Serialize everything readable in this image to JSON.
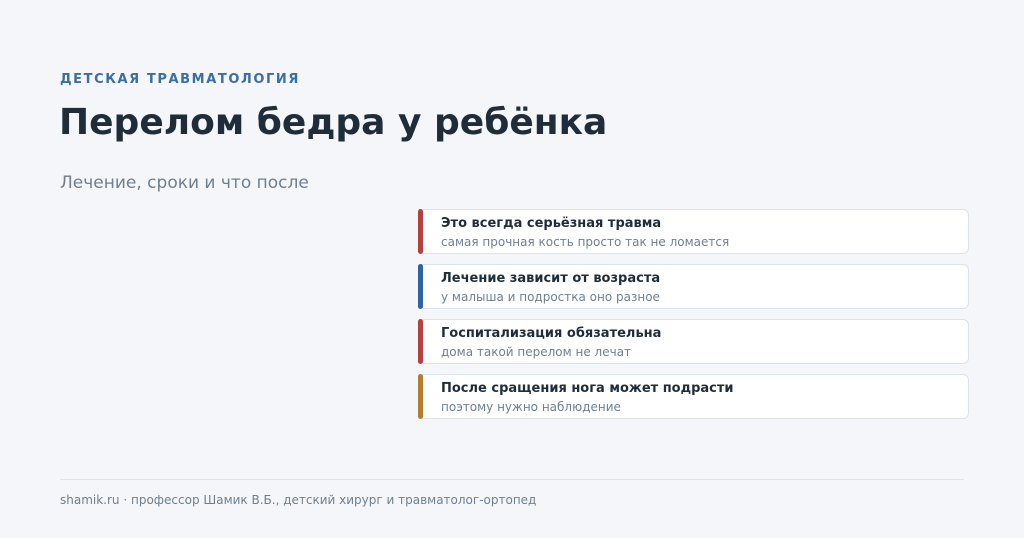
{
  "header": {
    "eyebrow": "ДЕТСКАЯ ТРАВМАТОЛОГИЯ",
    "title": "Перелом бедра у ребёнка",
    "subtitle": "Лечение, сроки и что после"
  },
  "cards": [
    {
      "title": "Это всегда серьёзная травма",
      "subtitle": "самая прочная кость просто так не ломается",
      "accent": "#b5413f"
    },
    {
      "title": "Лечение зависит от возраста",
      "subtitle": "у малыша и подростка оно разное",
      "accent": "#2f64a4"
    },
    {
      "title": "Госпитализация обязательна",
      "subtitle": "дома такой перелом не лечат",
      "accent": "#b5413f"
    },
    {
      "title": "После сращения нога может подрасти",
      "subtitle": "поэтому нужно наблюдение",
      "accent": "#b37c2e"
    }
  ],
  "footer": {
    "text": "shamik.ru · профессор Шамик В.Б., детский хирург и травматолог-ортопед"
  }
}
